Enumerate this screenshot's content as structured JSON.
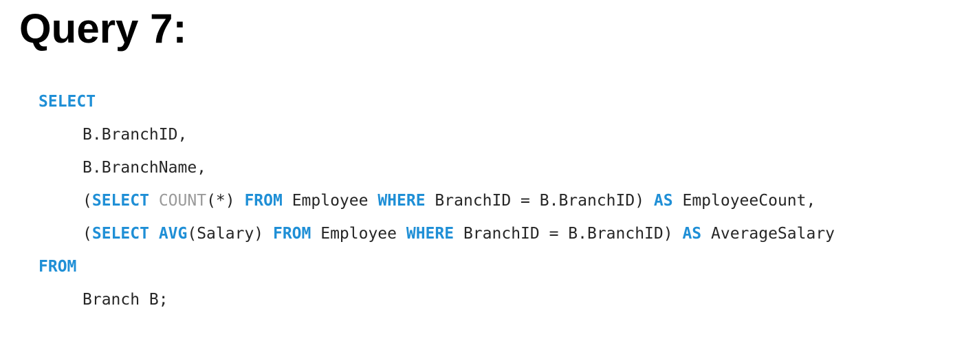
{
  "page": {
    "title": "Query 7:"
  },
  "colors": {
    "keyword": "#1f8fd6",
    "function": "#9a9a9a",
    "text": "#262626"
  },
  "code": {
    "lines": [
      [
        {
          "t": "SELECT",
          "k": "kw"
        }
      ],
      [
        {
          "t": "B.BranchID,",
          "k": "tx"
        }
      ],
      [
        {
          "t": "B.BranchName,",
          "k": "tx"
        }
      ],
      [
        {
          "t": "(",
          "k": "tx"
        },
        {
          "t": "SELECT",
          "k": "kw"
        },
        {
          "t": " ",
          "k": "tx"
        },
        {
          "t": "COUNT",
          "k": "fn"
        },
        {
          "t": "(*) ",
          "k": "tx"
        },
        {
          "t": "FROM",
          "k": "kw"
        },
        {
          "t": " Employee ",
          "k": "tx"
        },
        {
          "t": "WHERE",
          "k": "kw"
        },
        {
          "t": " BranchID = B.BranchID) ",
          "k": "tx"
        },
        {
          "t": "AS",
          "k": "kw"
        },
        {
          "t": " EmployeeCount,",
          "k": "tx"
        }
      ],
      [
        {
          "t": "(",
          "k": "tx"
        },
        {
          "t": "SELECT",
          "k": "kw"
        },
        {
          "t": " ",
          "k": "tx"
        },
        {
          "t": "AVG",
          "k": "kw"
        },
        {
          "t": "(Salary) ",
          "k": "tx"
        },
        {
          "t": "FROM",
          "k": "kw"
        },
        {
          "t": " Employee ",
          "k": "tx"
        },
        {
          "t": "WHERE",
          "k": "kw"
        },
        {
          "t": " BranchID = B.BranchID) ",
          "k": "tx"
        },
        {
          "t": "AS",
          "k": "kw"
        },
        {
          "t": " AverageSalary",
          "k": "tx"
        }
      ],
      [
        {
          "t": "FROM",
          "k": "kw"
        }
      ],
      [
        {
          "t": "Branch B;",
          "k": "tx"
        }
      ]
    ]
  }
}
